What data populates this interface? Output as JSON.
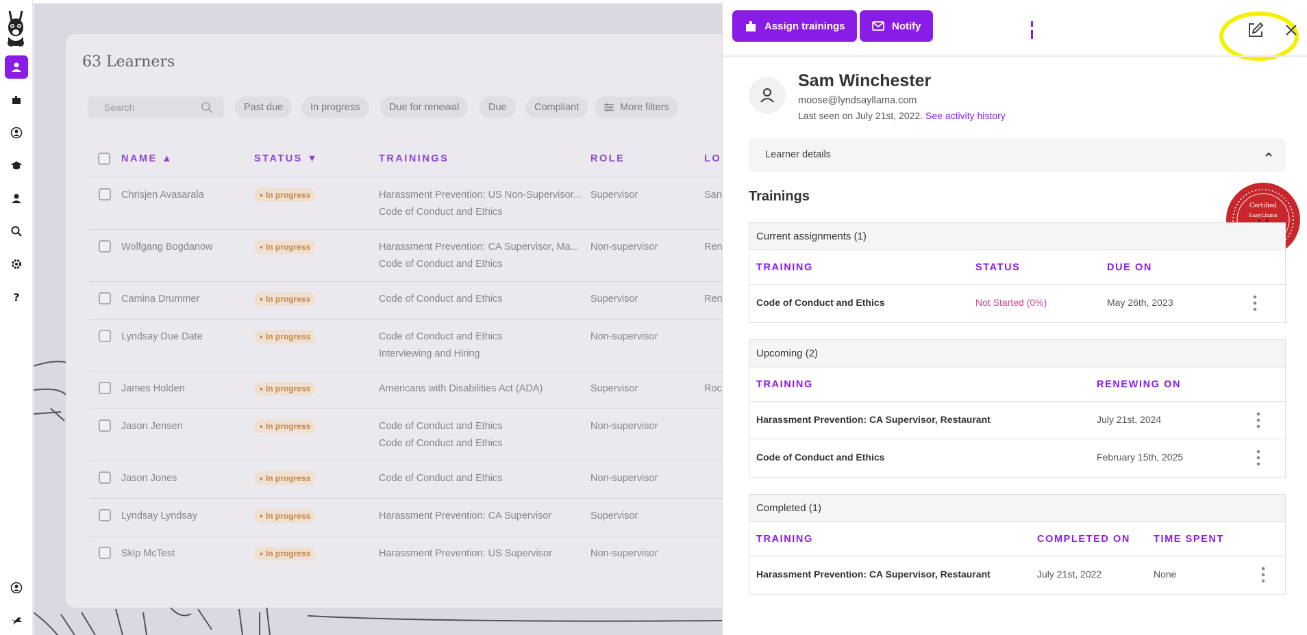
{
  "sidebar": {
    "logo_label": "Llama logo",
    "items": [
      "learners",
      "trainings",
      "account",
      "courses",
      "people",
      "search",
      "settings",
      "help"
    ],
    "bottom_items": [
      "profile",
      "bird"
    ]
  },
  "learners": {
    "title": "63 Learners",
    "search_placeholder": "Search",
    "filters": [
      "Past due",
      "In progress",
      "Due for renewal",
      "Due",
      "Compliant"
    ],
    "more_filters": "More filters",
    "columns": [
      "NAME ▲",
      "STATUS ▼",
      "TRAININGS",
      "ROLE",
      "LO"
    ],
    "rows": [
      {
        "name": "Chrisjen Avasarala",
        "status": "In progress",
        "trainings": [
          "Harassment Prevention: US Non-Supervisor...",
          "Code of Conduct and Ethics"
        ],
        "role": "Supervisor",
        "location": "San"
      },
      {
        "name": "Wolfgang Bogdanow",
        "status": "In progress",
        "trainings": [
          "Harassment Prevention: CA Supervisor, Ma...",
          "Code of Conduct and Ethics"
        ],
        "role": "Non-supervisor",
        "location": "Ren"
      },
      {
        "name": "Camina Drummer",
        "status": "In progress",
        "trainings": [
          "Code of Conduct and Ethics"
        ],
        "role": "Supervisor",
        "location": "Ren"
      },
      {
        "name": "Lyndsay Due Date",
        "status": "In progress",
        "trainings": [
          "Code of Conduct and Ethics",
          "Interviewing and Hiring"
        ],
        "role": "Non-supervisor",
        "location": ""
      },
      {
        "name": "James Holden",
        "status": "In progress",
        "trainings": [
          "Americans with Disabilities Act (ADA)"
        ],
        "role": "Supervisor",
        "location": "Roc"
      },
      {
        "name": "Jason Jensen",
        "status": "In progress",
        "trainings": [
          "Code of Conduct and Ethics",
          "Code of Conduct and Ethics"
        ],
        "role": "Non-supervisor",
        "location": ""
      },
      {
        "name": "Jason Jones",
        "status": "In progress",
        "trainings": [
          "Code of Conduct and Ethics"
        ],
        "role": "Non-supervisor",
        "location": ""
      },
      {
        "name": "Lyndsay Lyndsay",
        "status": "In progress",
        "trainings": [
          "Harassment Prevention: CA Supervisor"
        ],
        "role": "Supervisor",
        "location": ""
      },
      {
        "name": "Skip McTest",
        "status": "In progress",
        "trainings": [
          "Harassment Prevention: US Supervisor"
        ],
        "role": "Non-supervisor",
        "location": ""
      }
    ]
  },
  "panel": {
    "assign_label": "Assign trainings",
    "notify_label": "Notify",
    "user": {
      "name": "Sam Winchester",
      "email": "moose@lyndsayllama.com",
      "last_seen": "Last seen on July 21st, 2022.",
      "activity_link": "See activity history"
    },
    "details_label": "Learner details",
    "trainings_title": "Trainings",
    "seal_text": "Certified EasyLlama",
    "current": {
      "title": "Current assignments (1)",
      "columns": [
        "TRAINING",
        "STATUS",
        "DUE ON"
      ],
      "rows": [
        {
          "training": "Code of Conduct and Ethics",
          "status": "Not Started (0%)",
          "due": "May 26th, 2023"
        }
      ]
    },
    "upcoming": {
      "title": "Upcoming (2)",
      "columns": [
        "TRAINING",
        "RENEWING ON"
      ],
      "rows": [
        {
          "training": "Harassment Prevention: CA Supervisor, Restaurant",
          "renewing": "July 21st, 2024"
        },
        {
          "training": "Code of Conduct and Ethics",
          "renewing": "February 15th, 2025"
        }
      ]
    },
    "completed": {
      "title": "Completed (1)",
      "columns": [
        "TRAINING",
        "COMPLETED ON",
        "TIME SPENT"
      ],
      "rows": [
        {
          "training": "Harassment Prevention: CA Supervisor, Restaurant",
          "completed": "July 21st, 2022",
          "time": "None"
        }
      ]
    }
  },
  "colors": {
    "accent": "#8a1ce8",
    "header_text": "#6d12c9",
    "badge_bg": "#f2e0c8",
    "badge_text": "#b66a14",
    "status_pink": "#c2478e",
    "highlight": "#f5f000",
    "seal": "#c8282d"
  }
}
